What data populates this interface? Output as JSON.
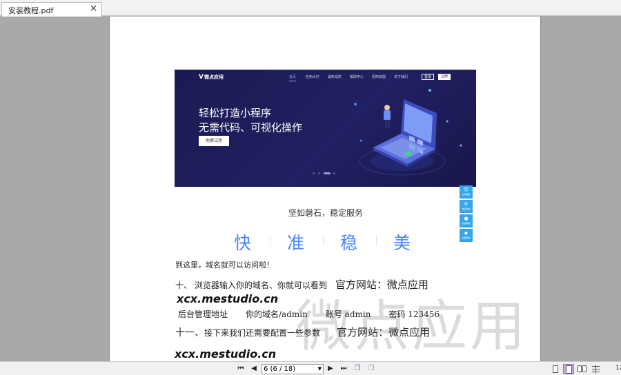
{
  "tab": {
    "title": "安装教程.pdf",
    "close": "×"
  },
  "banner": {
    "logo": "微点应用",
    "nav": [
      "首页",
      "应用大厅",
      "最新动态",
      "帮助中心",
      "招商加盟",
      "关于我们"
    ],
    "login": "登录",
    "register": "注册",
    "title1": "轻松打造小程序",
    "title2": "无需代码、可视化操作",
    "cta": "免费试用"
  },
  "float_buttons": [
    "在线客服",
    "电话咨询",
    "微信客服",
    "加盟咨询"
  ],
  "content": {
    "tagline": "坚如磐石，稳定服务",
    "features": [
      "快",
      "准",
      "稳",
      "美"
    ],
    "line_reachable": "到这里，域名就可以访问啦！",
    "line_ten": "十、 浏览器输入你的域名、你就可以看到",
    "line_ten_site": "官方网站：微点应用",
    "url1": "xcx.mestudio.cn",
    "admin_label": "后台管理地址",
    "admin_path": "你的域名/admin",
    "account": "账号 admin",
    "password": "密码  123456",
    "line_eleven_num": "十一、",
    "line_eleven": "接下来我们还需要配置一些参数",
    "line_eleven_site": "官方网站：微点应用",
    "url2": "xcx.mestudio.cn",
    "watermark": "微点应用"
  },
  "toolbar": {
    "page_value": "6 (6 / 18)",
    "zoom": "12"
  },
  "colors": {
    "banner_bg": "#1c1a52",
    "feature_blue": "#4a84ff",
    "float_blue": "#36a6e8",
    "active_view": "#c8a7e8"
  }
}
